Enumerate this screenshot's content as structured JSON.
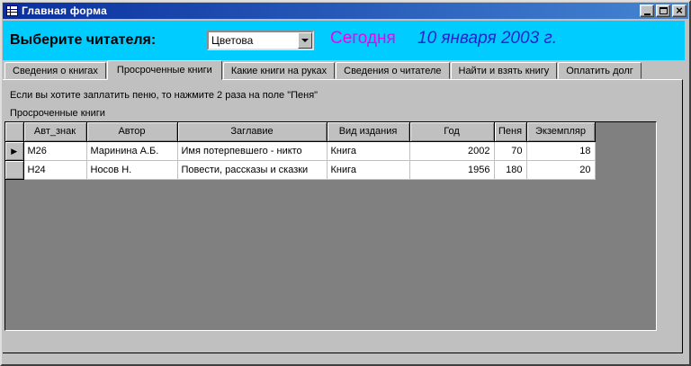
{
  "window": {
    "title": "Главная форма"
  },
  "icons": {
    "window_icon": "form-grid-icon",
    "minimize": "minimize-icon",
    "maximize": "maximize-icon",
    "close": "close-icon",
    "combo_arrow": "chevron-down-icon",
    "record_marker": "current-record-arrow"
  },
  "banner": {
    "reader_label": "Выберите читателя:",
    "reader_value": "Цветова",
    "today_label": "Сегодня",
    "date_text": "10 января 2003 г."
  },
  "tabs": [
    {
      "label": "Сведения о книгах",
      "active": false
    },
    {
      "label": "Просроченные книги",
      "active": true
    },
    {
      "label": "Какие книги на руках",
      "active": false
    },
    {
      "label": "Сведения о читателе",
      "active": false
    },
    {
      "label": "Найти и взять книгу",
      "active": false
    },
    {
      "label": "Оплатить долг",
      "active": false
    }
  ],
  "page": {
    "hint": "Если вы хотите заплатить пеню, то нажмите 2 раза на поле \"Пеня\"",
    "table_label": "Просроченные книги"
  },
  "table": {
    "current_marker": "▶",
    "columns": [
      "Авт_знак",
      "Автор",
      "Заглавие",
      "Вид издания",
      "Год",
      "Пеня",
      "Экземпляр"
    ],
    "rows": [
      [
        "М26",
        "Маринина А.Б.",
        "Имя потерпевшего - никто",
        "Книга",
        "2002",
        "70",
        "18"
      ],
      [
        "Н24",
        "Носов Н.",
        "Повести, рассказы и сказки",
        "Книга",
        "1956",
        "180",
        "20"
      ]
    ]
  },
  "colors": {
    "banner": "#00ccff",
    "today": "#ee00ee",
    "date": "#2323cb",
    "titlebar_start": "#0a2f9e",
    "titlebar_end": "#4585d2"
  }
}
